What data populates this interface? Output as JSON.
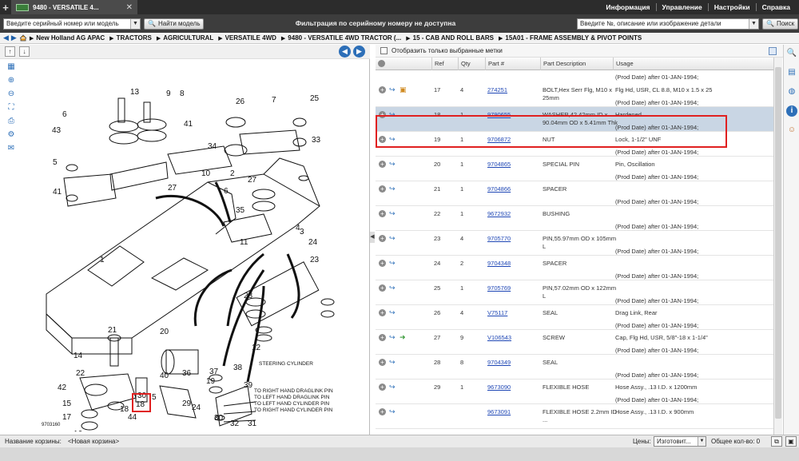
{
  "tab": {
    "title": "9480 - VERSATILE 4..."
  },
  "topmenu": [
    "Информация",
    "Управление",
    "Настройки",
    "Справка"
  ],
  "search": {
    "serial_select": "Введите серийный номер или модель",
    "find_model": "Найти модель",
    "filter_msg": "Фильтрация по серийному номеру не доступна",
    "part_select": "Введите №, описание или изображение детали",
    "search_button": "Поиск"
  },
  "breadcrumb": [
    "New Holland AG APAC",
    "TRACTORS",
    "AGRICULTURAL",
    "VERSATILE 4WD",
    "9480 - VERSATILE 4WD TRACTOR (...",
    "15 - CAB AND ROLL BARS",
    "15A01 - FRAME ASSEMBLY & PIVOT POINTS"
  ],
  "parts_panel": {
    "show_selected_label": "Отобразить только выбранные метки",
    "columns": {
      "ref": "Ref",
      "qty": "Qty",
      "part": "Part #",
      "desc": "Part Description",
      "usage": "Usage"
    },
    "preceding_date": "(Prod Date) after 01-JAN-1994;",
    "rows": [
      {
        "ref": "17",
        "qty": "4",
        "part": "274251",
        "desc": "BOLT,Hex Serr Flg, M10 x 25mm",
        "usage": "Flg Hd, USR, CL 8.8, M10 x 1.5 x 25",
        "date": "(Prod Date) after 01-JAN-1994;",
        "extra": "box"
      },
      {
        "ref": "18",
        "qty": "1",
        "part": "9790655",
        "desc": "WASHER,42.42mm ID x 90.04mm OD x 5.41mm Thk",
        "usage": "Hardened",
        "date": "(Prod Date) after 01-JAN-1994;",
        "selected": true
      },
      {
        "ref": "19",
        "qty": "1",
        "part": "9706872",
        "desc": "NUT",
        "usage": "Lock, 1-1/2\" UNF",
        "date": "(Prod Date) after 01-JAN-1994;"
      },
      {
        "ref": "20",
        "qty": "1",
        "part": "9704865",
        "desc": "SPECIAL PIN",
        "usage": "Pin, Oscillation",
        "date": "(Prod Date) after 01-JAN-1994;"
      },
      {
        "ref": "21",
        "qty": "1",
        "part": "9704866",
        "desc": "SPACER",
        "usage": "",
        "date": "(Prod Date) after 01-JAN-1994;"
      },
      {
        "ref": "22",
        "qty": "1",
        "part": "9672932",
        "desc": "BUSHING",
        "usage": "",
        "date": "(Prod Date) after 01-JAN-1994;"
      },
      {
        "ref": "23",
        "qty": "4",
        "part": "9705770",
        "desc": "PIN,55.97mm OD x 105mm L",
        "usage": "",
        "date": "(Prod Date) after 01-JAN-1994;"
      },
      {
        "ref": "24",
        "qty": "2",
        "part": "9704348",
        "desc": "SPACER",
        "usage": "",
        "date": "(Prod Date) after 01-JAN-1994;"
      },
      {
        "ref": "25",
        "qty": "1",
        "part": "9705769",
        "desc": "PIN,57.02mm OD x 122mm L",
        "usage": "",
        "date": "(Prod Date) after 01-JAN-1994;"
      },
      {
        "ref": "26",
        "qty": "4",
        "part": "V75117",
        "desc": "SEAL",
        "usage": "Drag Link, Rear",
        "date": "(Prod Date) after 01-JAN-1994;"
      },
      {
        "ref": "27",
        "qty": "9",
        "part": "V106543",
        "desc": "SCREW",
        "usage": "Cap, Flg Hd, USR, 5/8\"-18 x 1-1/4\"",
        "date": "(Prod Date) after 01-JAN-1994;",
        "extra": "arrow"
      },
      {
        "ref": "28",
        "qty": "8",
        "part": "9704349",
        "desc": "SEAL",
        "usage": "",
        "date": "(Prod Date) after 01-JAN-1994;"
      },
      {
        "ref": "29",
        "qty": "1",
        "part": "9673090",
        "desc": "FLEXIBLE HOSE",
        "usage": "Hose Assy., .13 I.D. x 1200mm",
        "date": "(Prod Date) after 01-JAN-1994;"
      },
      {
        "ref": "",
        "qty": "",
        "part": "9673091",
        "desc": "FLEXIBLE HOSE 2.2mm ID ...",
        "usage": "Hose Assy., .13 I.D. x 900mm",
        "date": ""
      }
    ]
  },
  "diagram": {
    "callouts": [
      "13",
      "9",
      "8",
      "6",
      "26",
      "7",
      "25",
      "41",
      "33",
      "34",
      "43",
      "5",
      "10",
      "27",
      "2",
      "27",
      "41",
      "6",
      "35",
      "3",
      "24",
      "11",
      "4",
      "1",
      "23",
      "28",
      "12",
      "14",
      "22",
      "42",
      "15",
      "17",
      "16",
      "21",
      "20",
      "40",
      "36",
      "37",
      "38",
      "39",
      "29",
      "30",
      "32",
      "31",
      "30",
      "44",
      "18",
      "19",
      "5",
      "24"
    ],
    "ref_highlight": "18",
    "labels": {
      "steering": "STEERING CYLINDER",
      "rh_drag": "TO RIGHT HAND DRAGLINK PIN",
      "lh_drag": "TO LEFT HAND DRAGLINK PIN",
      "lh_cyl": "TO LEFT HAND CYLINDER PIN",
      "rh_cyl": "TO RIGHT HAND CYLINDER PIN",
      "drawing_no": "9703160"
    }
  },
  "footer": {
    "basket_label": "Название корзины:",
    "basket_value": "<Новая корзина>",
    "prices_label": "Цены:",
    "prices_value": "Изготовит...",
    "total": "Общее кол-во: 0"
  },
  "colors": {
    "accent": "#2d6fb8",
    "highlight": "#e02020",
    "selected_row": "#c9d6e4",
    "topbar": "#2c2c2c"
  }
}
